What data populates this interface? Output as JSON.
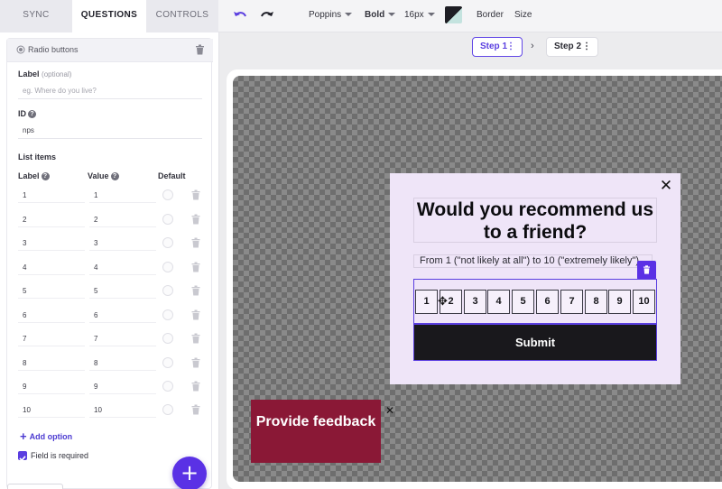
{
  "tabs": [
    {
      "label": "SYNC"
    },
    {
      "label": "QUESTIONS"
    },
    {
      "label": "CONTROLS"
    }
  ],
  "toolbar": {
    "font": "Poppins",
    "weight": "Bold",
    "size": "16px",
    "border_label": "Border",
    "size_label": "Size",
    "color_swatch": "#1e1e24",
    "accent": "#5a31e5"
  },
  "steps": [
    {
      "label": "Step 1"
    },
    {
      "label": "Step 2"
    }
  ],
  "panel": {
    "title": "Radio buttons",
    "label_field": {
      "label": "Label",
      "optional": "(optional)",
      "placeholder": "eg. Where do you live?"
    },
    "id_field": {
      "label": "ID",
      "value": "nps"
    },
    "list_items": {
      "heading": "List items",
      "col_label": "Label",
      "col_value": "Value",
      "col_default": "Default",
      "rows": [
        {
          "label": "1",
          "value": "1"
        },
        {
          "label": "2",
          "value": "2"
        },
        {
          "label": "3",
          "value": "3"
        },
        {
          "label": "4",
          "value": "4"
        },
        {
          "label": "5",
          "value": "5"
        },
        {
          "label": "6",
          "value": "6"
        },
        {
          "label": "7",
          "value": "7"
        },
        {
          "label": "8",
          "value": "8"
        },
        {
          "label": "9",
          "value": "9"
        },
        {
          "label": "10",
          "value": "10"
        }
      ]
    },
    "add_option": "Add option",
    "required_label": "Field is required",
    "required_checked": true
  },
  "modal": {
    "question": "Would you recommend us to a friend?",
    "subtitle": "From 1 (\"not likely at all\") to 10 (\"extremely likely\")",
    "scale": [
      "1",
      "2",
      "3",
      "4",
      "5",
      "6",
      "7",
      "8",
      "9",
      "10"
    ],
    "submit": "Submit",
    "background": "#efe5f8"
  },
  "feedback_tab": {
    "label": "Provide feedback",
    "color": "#8a1836"
  }
}
